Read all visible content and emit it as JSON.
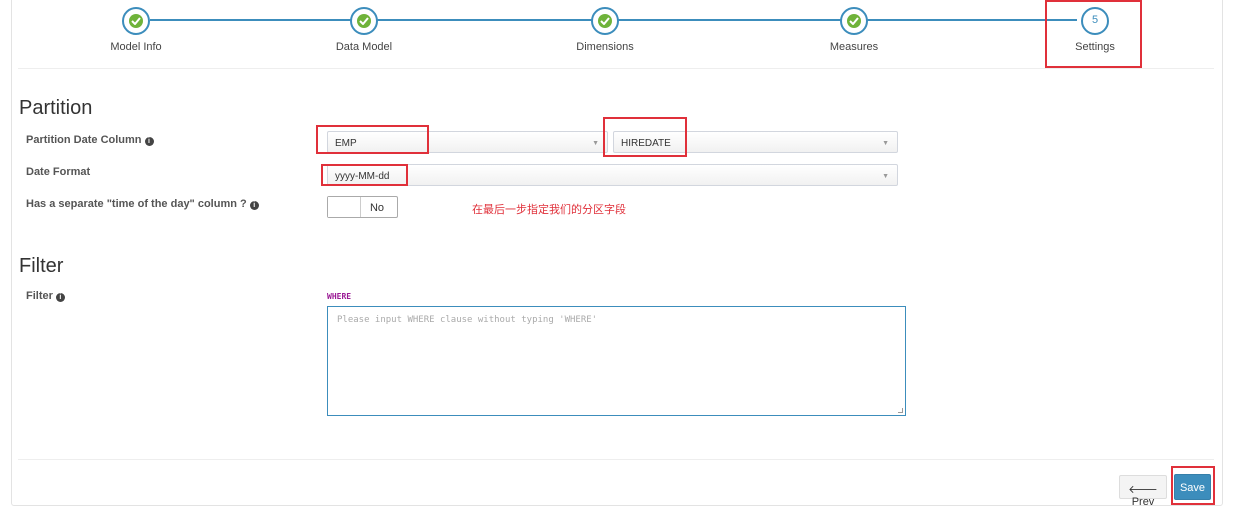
{
  "wizard": {
    "steps": [
      {
        "label": "Model Info",
        "state": "done"
      },
      {
        "label": "Data Model",
        "state": "done"
      },
      {
        "label": "Dimensions",
        "state": "done"
      },
      {
        "label": "Measures",
        "state": "done"
      },
      {
        "label": "Settings",
        "state": "current",
        "number": "5"
      }
    ]
  },
  "partition": {
    "title": "Partition",
    "date_column_label": "Partition Date Column",
    "table_value": "EMP",
    "column_value": "HIREDATE",
    "date_format_label": "Date Format",
    "date_format_value": "yyyy-MM-dd",
    "time_column_label": "Has a separate \"time of the day\" column ?",
    "time_column_toggle": "No",
    "annotation_note": "在最后一步指定我们的分区字段"
  },
  "filter": {
    "title": "Filter",
    "label": "Filter",
    "keyword": "WHERE",
    "placeholder": "Please input WHERE clause without typing 'WHERE'"
  },
  "footer": {
    "prev_label": "Prev",
    "save_label": "Save"
  },
  "colors": {
    "accent": "#3c8dbc",
    "done": "#6fb33a",
    "annotation": "#e0303a",
    "keyword": "#9b1a95"
  },
  "icons": {
    "step_done": "check-icon",
    "info": "info-circle-icon",
    "prev": "arrow-left-icon",
    "dropdown": "caret-down-icon"
  }
}
